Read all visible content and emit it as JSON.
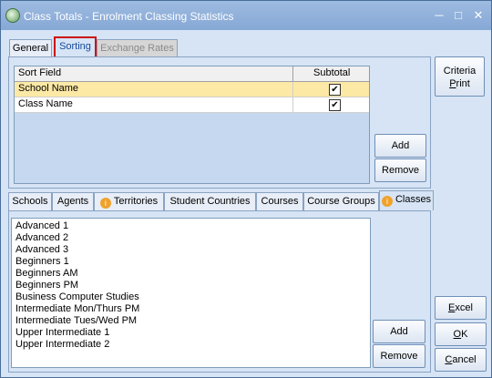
{
  "window": {
    "title": "Class Totals - Enrolment Classing Statistics",
    "minimize": "─",
    "maximize": "□",
    "close": "✕"
  },
  "top_tabs": [
    "General",
    "Sorting",
    "Exchange Rates"
  ],
  "sort_grid": {
    "headers": [
      "Sort Field",
      "Subtotal"
    ],
    "rows": [
      {
        "field": "School Name",
        "subtotal": "✔"
      },
      {
        "field": "Class Name",
        "subtotal": "✔"
      }
    ]
  },
  "top_buttons": {
    "add": "Add",
    "remove": "Remove"
  },
  "criteria_button": {
    "line1": "Criteria",
    "line2_prefix": "",
    "line2_u": "P",
    "line2_suffix": "rint"
  },
  "bottom_tabs": [
    "Schools",
    "Agents",
    "Territories",
    "Student Countries",
    "Courses",
    "Course Groups",
    "Classes"
  ],
  "classes": [
    "Advanced 1",
    "Advanced 2",
    "Advanced 3",
    "Beginners 1",
    "Beginners AM",
    "Beginners PM",
    "Business Computer Studies",
    "Intermediate Mon/Thurs PM",
    "Intermediate Tues/Wed PM",
    "Upper Intermediate 1",
    "Upper Intermediate 2"
  ],
  "bottom_buttons": {
    "add": "Add",
    "remove": "Remove"
  },
  "side_buttons": {
    "excel": {
      "u": "E",
      "rest": "xcel"
    },
    "ok": {
      "u": "O",
      "rest": "K"
    },
    "cancel": {
      "u": "C",
      "rest": "ancel"
    }
  },
  "colors": {
    "accent_highlight": "#cc1111",
    "selected_row": "#fde9a6",
    "info_icon": "#f0a22b"
  }
}
